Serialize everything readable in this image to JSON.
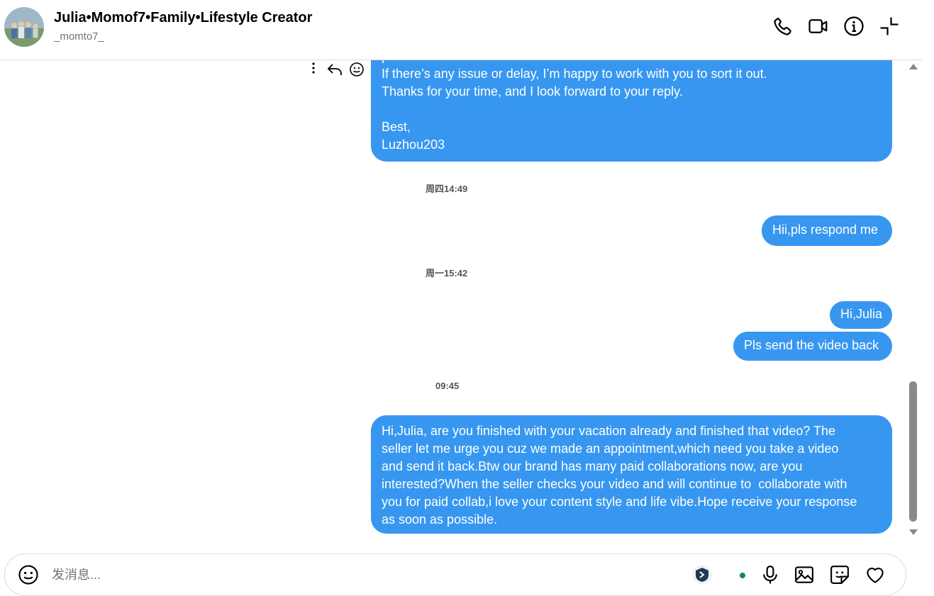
{
  "header": {
    "name": "Julia•Momof7•Family•Lifestyle Creator",
    "handle": "_momto7_",
    "icons": [
      "phone-icon",
      "video-camera-icon",
      "info-icon",
      "minimize-icon"
    ]
  },
  "messages": {
    "first_bubble_lines": "please let me know the status.\nIf there’s any issue or delay, I’m happy to work with you to sort it out.\nThanks for your time, and I look forward to your reply.\n\nBest,\nLuzhou203",
    "ts1": "周四14:49",
    "msg2": "Hii,pls respond me",
    "ts2": "周一15:42",
    "msg3": "Hi,Julia",
    "msg4": "Pls send the video back",
    "ts3": "09:45",
    "msg5": "Hi,Julia, are you finished with your vacation already and finished that video? The\nseller let me urge you cuz we made an appointment,which need you take a video\nand send it back.Btw our brand has many paid collaborations now, are you\ninterested?When the seller checks your video and will continue to  collaborate with\nyou for paid collab,i love your content style and life vibe.Hope receive your response\nas soon as possible."
  },
  "composer": {
    "placeholder": "发消息..."
  },
  "colors": {
    "bubble": "#3797f0",
    "accent_dot": "#0a8a5f"
  }
}
